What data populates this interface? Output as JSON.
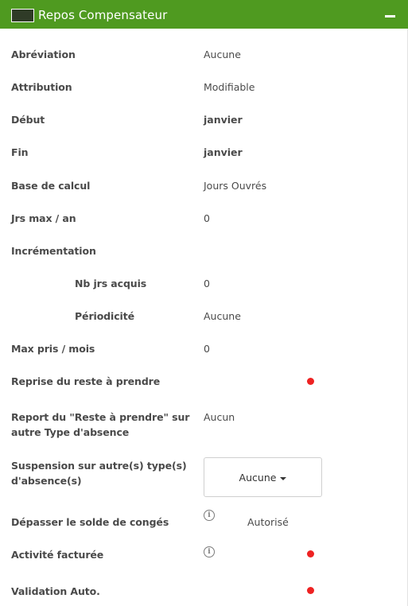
{
  "header": {
    "title": "Repos Compensateur",
    "swatch_color": "#2f3b27",
    "bar_color": "#4f9a20",
    "collapse_icon": "minus-icon"
  },
  "fields": {
    "abreviation": {
      "label": "Abréviation",
      "value": "Aucune"
    },
    "attribution": {
      "label": "Attribution",
      "value": "Modifiable"
    },
    "debut": {
      "label": "Début",
      "value": "janvier"
    },
    "fin": {
      "label": "Fin",
      "value": "janvier"
    },
    "base_calcul": {
      "label": "Base de calcul",
      "value": "Jours Ouvrés"
    },
    "jrs_max": {
      "label": "Jrs max / an",
      "value": "0"
    },
    "incrementation": {
      "label": "Incrémentation"
    },
    "nb_jrs_acquis": {
      "label": "Nb jrs acquis",
      "value": "0"
    },
    "periodicite": {
      "label": "Périodicité",
      "value": "Aucune"
    },
    "max_pris": {
      "label": "Max pris / mois",
      "value": "0"
    },
    "reprise": {
      "label": "Reprise du reste à prendre",
      "status_color": "#ee2222"
    },
    "report": {
      "label": "Report du \"Reste à prendre\" sur autre Type d'absence",
      "value": "Aucun"
    },
    "suspension": {
      "label": "Suspension sur autre(s) type(s) d'absence(s)",
      "dropdown_value": "Aucune"
    },
    "depasser": {
      "label": "Dépasser le solde de congés",
      "info_icon": "info-icon",
      "value": "Autorisé"
    },
    "activite": {
      "label": "Activité facturée",
      "info_icon": "info-icon",
      "status_color": "#ee2222"
    },
    "validation": {
      "label": "Validation Auto.",
      "status_color": "#ee2222"
    }
  }
}
